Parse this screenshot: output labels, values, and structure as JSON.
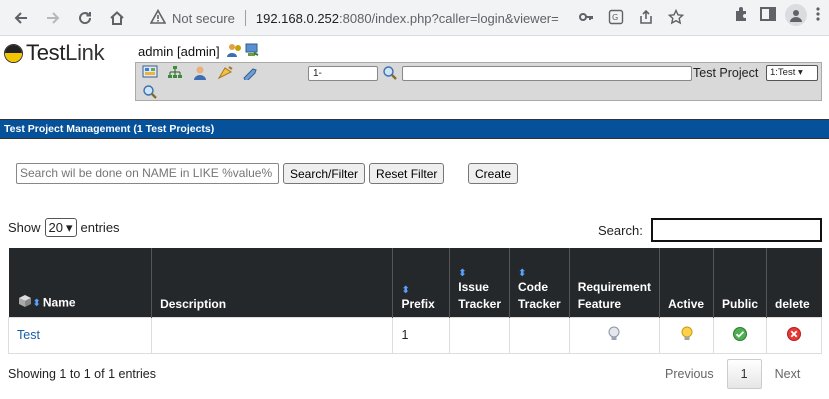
{
  "browser": {
    "security_label": "Not secure",
    "url_host": "192.168.0.252",
    "url_rest": ":8080/index.php?caller=login&viewer="
  },
  "app": {
    "logo_test": "Test",
    "logo_link": "Link",
    "user": "admin [admin]"
  },
  "toolbar": {
    "select_value": "1-",
    "project_label": "Test Project",
    "project_value": "1:Test"
  },
  "page": {
    "title": "Test Project Management (1 Test Projects)"
  },
  "filter": {
    "placeholder": "Search wil be done on NAME in LIKE %value%",
    "search_button": "Search/Filter",
    "reset_button": "Reset Filter",
    "create_button": "Create"
  },
  "table_controls": {
    "show_label": "Show",
    "entries_value": "20",
    "entries_label": "entries",
    "search_label": "Search:"
  },
  "table": {
    "headers": {
      "name": "Name",
      "description": "Description",
      "prefix": "Prefix",
      "issue_tracker_1": "Issue",
      "issue_tracker_2": "Tracker",
      "code_tracker_1": "Code",
      "code_tracker_2": "Tracker",
      "requirement_1": "Requirement",
      "requirement_2": "Feature",
      "active": "Active",
      "public": "Public",
      "delete": "delete"
    },
    "rows": [
      {
        "name": "Test",
        "description": "",
        "prefix": "1",
        "issue_tracker": "",
        "code_tracker": ""
      }
    ]
  },
  "footer": {
    "info": "Showing 1 to 1 of 1 entries",
    "previous": "Previous",
    "page": "1",
    "next": "Next"
  },
  "colors": {
    "title_bar": "#05529b",
    "table_header": "#25282b",
    "link": "#1b5ea8"
  }
}
